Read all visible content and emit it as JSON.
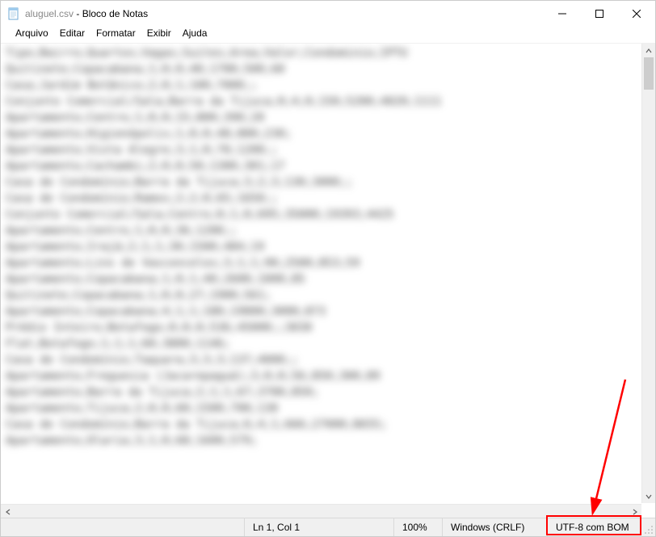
{
  "window": {
    "filename": "aluguel.csv",
    "app_title": " - Bloco de Notas"
  },
  "menubar": {
    "arquivo": "Arquivo",
    "editar": "Editar",
    "formatar": "Formatar",
    "exibir": "Exibir",
    "ajuda": "Ajuda"
  },
  "editor": {
    "blurred_text": "Tipo;Bairro;Quartos;Vagas;Suites;Area;Valor;Condominio;IPTU\nQuitinete;Copacabana;1;0;0;40;1700;500;60\nCasa;Jardim Botânico;2;0;1;100;7000;;\nConjunto Comercial/Sala;Barra da Tijuca;0;4;0;150;5200;4020;1111\nApartamento;Centro;1;0;0;15;800;390;20\nApartamento;Higienópolis;1;0;0;48;800;230;\nApartamento;Vista Alegre;3;1;0;70;1200;;\nApartamento;Cachambi;2;0;0;50;1300;301;17\nCasa de Condomínio;Barra da Tijuca;3;2;3;130;3000;;\nCasa de Condomínio;Ramos;2;2;0;65;1650;;\nConjunto Comercial/Sala;Centro;0;1;0;695;35000;19393;4425\nApartamento;Centro;1;0;0;36;1200;;\nApartamento;Irajá;2;1;1;30;1500;484;19\nApartamento;Lins de Vasconcelos;3;1;1;90;2500;853;59\nApartamento;Copacabana;1;0;1;40;2600;1000;85\nQuitinete;Copacabana;1;0;0;27;1900;561;\nApartamento;Copacabana;4;1;1;180;19000;3000;873\nPrédio Inteiro;Botafogo;0;0;0;536;45000;;3030\nFlat;Botafogo;1;1;1;60;3800;1146;\nCasa de Condomínio;Taquara;3;3;3;137;4000;;\nApartamento;Freguesia (Jacarepaguá);3;0;0;56;850;300;89\nApartamento;Barra da Tijuca;2;1;1;67;3700;850;\nApartamento;Tijuca;2;0;0;60;1500;700;130\nCasa de Condomínio;Barra da Tijuca;6;4;1;666;27000;8655;\nApartamento;Olaria;3;1;0;68;1600;579;"
  },
  "statusbar": {
    "position": "Ln 1, Col 1",
    "zoom": "100%",
    "line_ending": "Windows (CRLF)",
    "encoding": "UTF-8 com BOM"
  }
}
